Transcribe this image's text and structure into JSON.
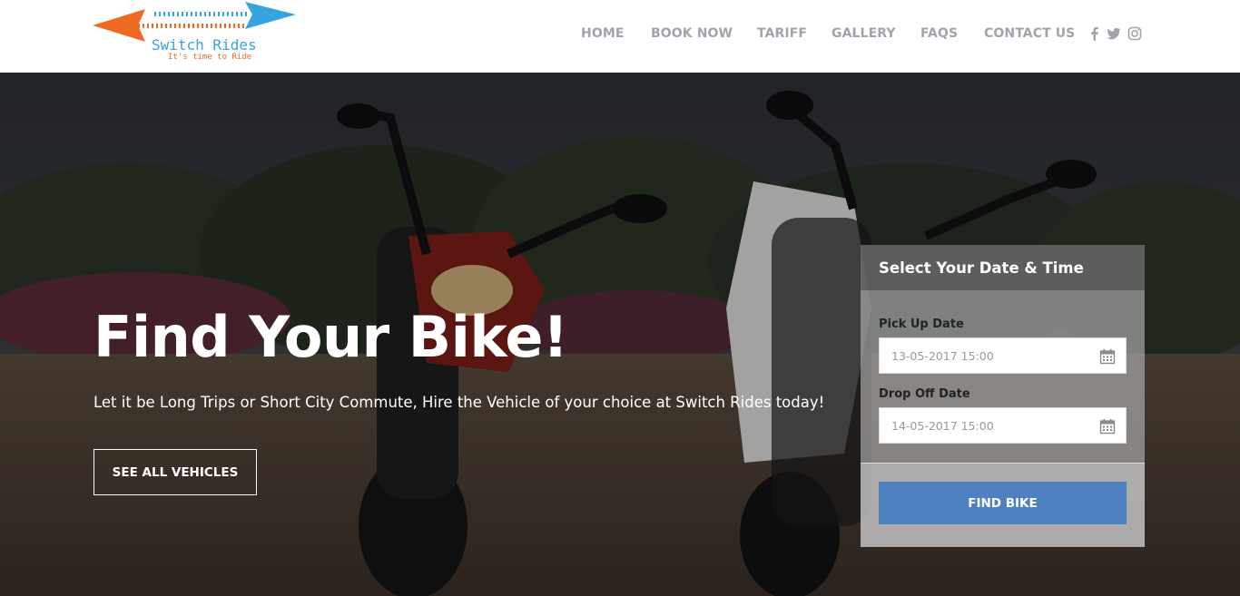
{
  "brand": {
    "name": "Switch Rides",
    "tagline": "It's time to Ride",
    "colors": {
      "arrow_left": "#ef6a23",
      "arrow_right": "#35a4df"
    }
  },
  "nav": {
    "items": [
      {
        "label": "HOME"
      },
      {
        "label": "BOOK NOW"
      },
      {
        "label": "TARIFF"
      },
      {
        "label": "GALLERY"
      },
      {
        "label": "FAQS"
      },
      {
        "label": "CONTACT US"
      }
    ],
    "social_icons": [
      "facebook-icon",
      "twitter-icon",
      "instagram-icon"
    ],
    "color": "#a0a4ab"
  },
  "hero": {
    "title": "Find Your Bike!",
    "subtitle": "Let it be Long Trips or Short City Commute, Hire the Vehicle of your choice at Switch Rides today!",
    "cta_label": "SEE ALL VEHICLES"
  },
  "booking": {
    "title": "Select Your Date & Time",
    "pickup_label": "Pick Up Date",
    "pickup_value": "13-05-2017 15:00",
    "dropoff_label": "Drop Off Date",
    "dropoff_value": "14-05-2017 15:00",
    "submit_label": "FIND BIKE",
    "accent": "#4f81c1"
  }
}
